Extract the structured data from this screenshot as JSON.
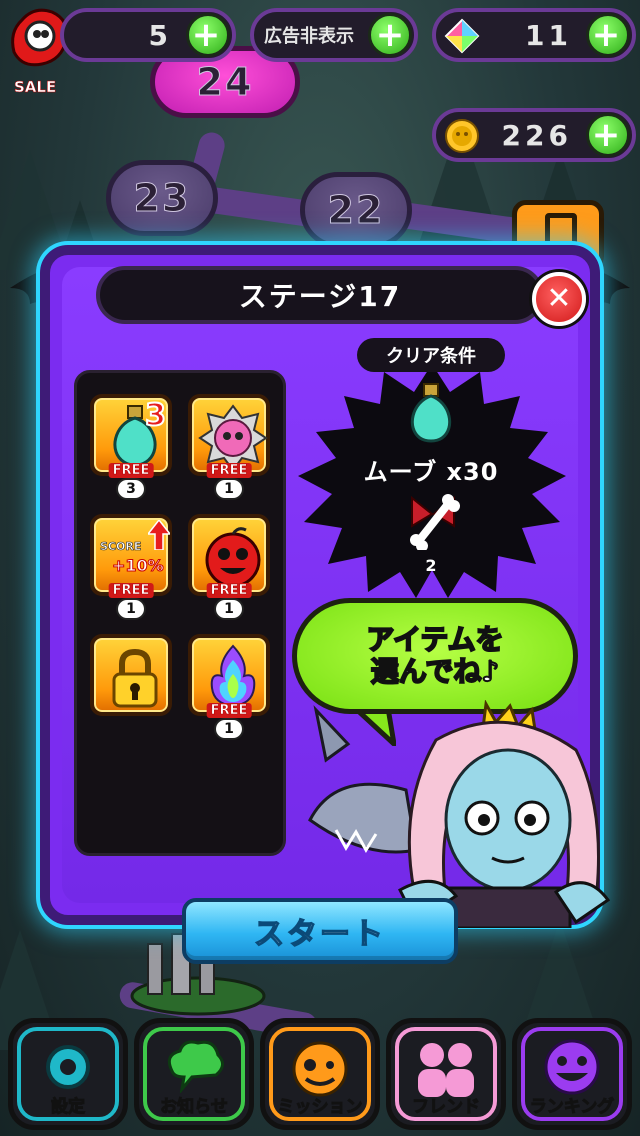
{
  "top_bar": {
    "sale_label": "SALE",
    "lives_count": "5",
    "ad_remove_label": "広告非表示",
    "gems_count": "11",
    "coins_count": "226"
  },
  "map": {
    "nodes": [
      "24",
      "23",
      "22"
    ]
  },
  "modal": {
    "title": "ステージ17",
    "close_symbol": "✕",
    "items": [
      {
        "name": "potion",
        "corner": "3",
        "free": "FREE",
        "count": "3"
      },
      {
        "name": "striped-bear",
        "free": "FREE",
        "count": "1"
      },
      {
        "name": "score-boost",
        "label_score": "SCORE",
        "label_bonus": "+10%",
        "free": "FREE",
        "count": "1"
      },
      {
        "name": "red-bomb-face",
        "free": "FREE",
        "count": "1"
      },
      {
        "name": "locked"
      },
      {
        "name": "rainbow-flame",
        "free": "FREE",
        "count": "1"
      }
    ],
    "clear_conditions": {
      "label": "クリア条件",
      "moves": "ムーブ x30",
      "bone_target": "2"
    },
    "speech": {
      "line1": "アイテムを",
      "line2": "選んでね♪"
    },
    "start_label": "スタート"
  },
  "nav": [
    {
      "label": "設定",
      "color": "#1fb8c9"
    },
    {
      "label": "お知らせ",
      "color": "#3ec94a"
    },
    {
      "label": "ミッション",
      "color": "#ff9a1a"
    },
    {
      "label": "フレンド",
      "color": "#f59ad6"
    },
    {
      "label": "ランキング",
      "color": "#9b3cf0"
    }
  ]
}
